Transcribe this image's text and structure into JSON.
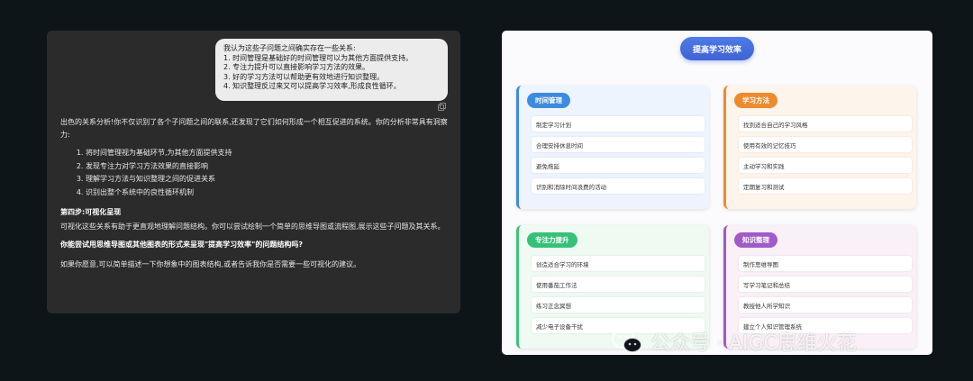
{
  "chat": {
    "user_message": [
      "我认为这些子问题之间确实存在一些关系:",
      "1. 时间管理是基础好的时间管理可以为其他方面提供支持。",
      "2. 专注力提升可以直接影响学习方法的效果。",
      "3. 好的学习方法可以帮助更有效地进行知识整理。",
      "4. 知识整理反过来又可以提高学习效率,形成良性循环。"
    ],
    "assistant": {
      "intro": "出色的关系分析!你不仅识别了各个子问题之间的联系,还发现了它们如何形成一个相互促进的系统。你的分析非常具有洞察力:",
      "points": [
        "将时间管理视为基础环节,为其他方面提供支持",
        "发现专注力对学习方法效果的直接影响",
        "理解学习方法与知识整理之间的促进关系",
        "识别出整个系统中的良性循环机制"
      ],
      "step_heading": "第四步:可视化呈现",
      "step_text": "可视化这些关系有助于更直观地理解问题结构。你可以尝试绘制一个简单的思维导图或流程图,展示这些子问题及其关系。",
      "question": "你能尝试用思维导图或其他图表的形式来呈现\"提高学习效率\"的问题结构吗?",
      "closing": "如果你愿意,可以简单描述一下你想象中的图表结构,或者告诉我你是否需要一些可视化的建议。"
    }
  },
  "mindmap": {
    "central": "提高学习效率",
    "branches": [
      {
        "title": "时间管理",
        "color": "#3d8be0",
        "items": [
          "制定学习计划",
          "合理安排休息时间",
          "避免拖延",
          "识别和消除时间浪费的活动"
        ]
      },
      {
        "title": "学习方法",
        "color": "#ee8a2e",
        "items": [
          "找到适合自己的学习风格",
          "使用有效的记忆技巧",
          "主动学习和实践",
          "定期复习和测试"
        ]
      },
      {
        "title": "专注力提升",
        "color": "#36c17a",
        "items": [
          "创造适合学习的环境",
          "使用番茄工作法",
          "练习正念冥想",
          "减少电子设备干扰"
        ]
      },
      {
        "title": "知识整理",
        "color": "#a05bc8",
        "items": [
          "制作思维导图",
          "写学习笔记和总结",
          "教授他人所学知识",
          "建立个人知识管理系统"
        ]
      }
    ]
  },
  "watermark": {
    "text": "公众号 · AIGC思维火花",
    "icon": "wechat-icon"
  }
}
